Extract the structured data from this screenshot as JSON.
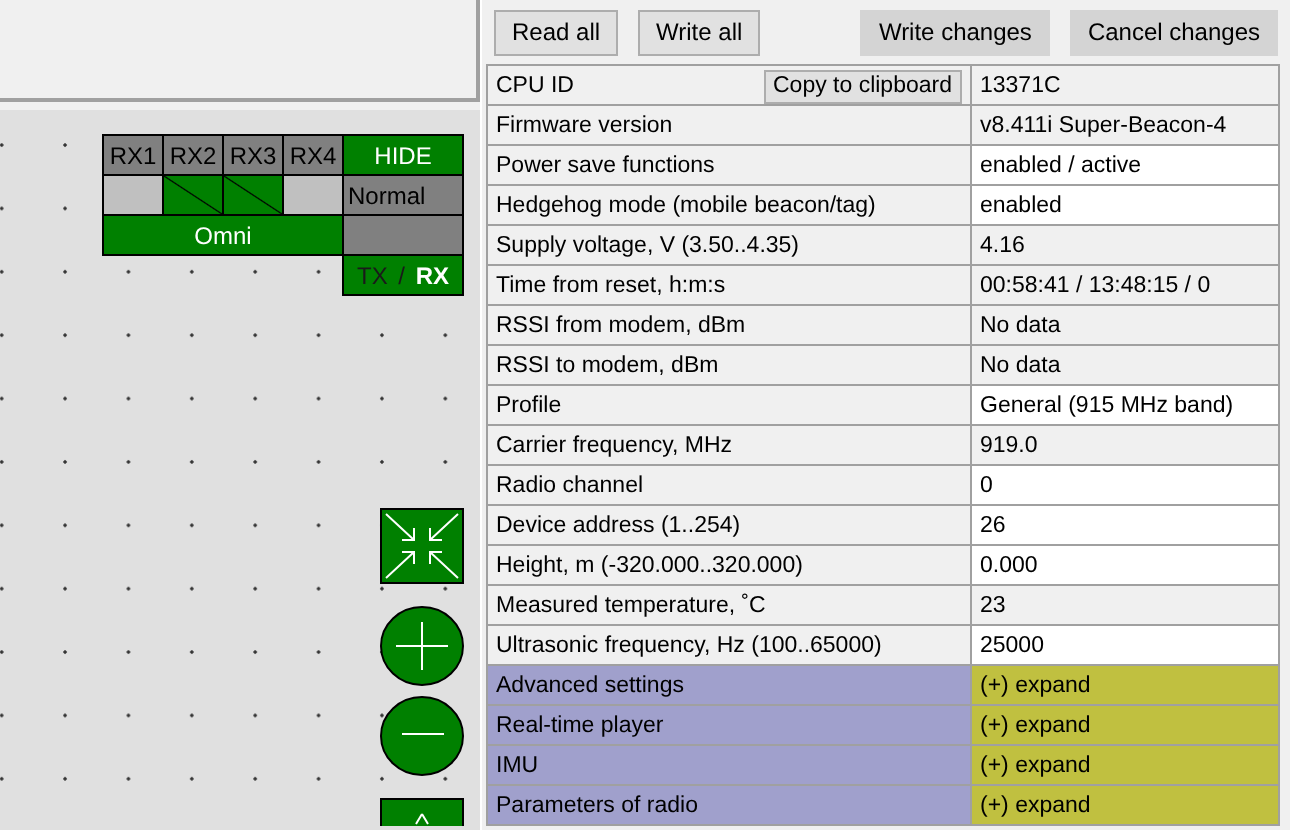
{
  "antenna_panel": {
    "receivers": [
      {
        "label": "RX1",
        "on": false
      },
      {
        "label": "RX2",
        "on": true
      },
      {
        "label": "RX3",
        "on": true
      },
      {
        "label": "RX4",
        "on": false
      }
    ],
    "hide_button": "HIDE",
    "mode": "Normal",
    "pattern": "Omni",
    "tx_rx": "TX / **RX**"
  },
  "toolbar": {
    "buttons": [
      {
        "label": "Read all",
        "shaded": false
      },
      {
        "label": "Write all",
        "shaded": false
      },
      {
        "label": "Write changes",
        "shaded": true
      },
      {
        "label": "Cancel changes",
        "shaded": true
      }
    ]
  },
  "properties": {
    "rows": [
      {
        "kind": "field",
        "label": "CPU ID",
        "action": "Copy to clipboard",
        "value": "13371C",
        "editable": false
      },
      {
        "kind": "field",
        "label": "Firmware version",
        "value": "v8.411i Super-Beacon-4",
        "editable": false
      },
      {
        "kind": "field",
        "label": "Power save functions",
        "value": "enabled / active",
        "editable": true
      },
      {
        "kind": "field",
        "label": "Hedgehog mode (mobile beacon/tag)",
        "value": "enabled",
        "editable": true
      },
      {
        "kind": "field",
        "label": "Supply voltage, V (3.50..4.35)",
        "value": "4.16",
        "editable": false
      },
      {
        "kind": "field",
        "label": "Time from reset, h:m:s",
        "value": "00:58:41 / 13:48:15 / 0",
        "editable": false
      },
      {
        "kind": "field",
        "label": "RSSI from modem, dBm",
        "value": "No data",
        "editable": false
      },
      {
        "kind": "field",
        "label": "RSSI to modem, dBm",
        "value": "No data",
        "editable": false
      },
      {
        "kind": "field",
        "label": "Profile",
        "value": "General (915 MHz band)",
        "editable": true
      },
      {
        "kind": "field",
        "label": "Carrier frequency, MHz",
        "value": "919.0",
        "editable": false
      },
      {
        "kind": "field",
        "label": "Radio channel",
        "value": "0",
        "editable": true
      },
      {
        "kind": "field",
        "label": "Device address (1..254)",
        "value": "26",
        "editable": true
      },
      {
        "kind": "field",
        "label": "Height, m (-320.000..320.000)",
        "value": "0.000",
        "editable": true
      },
      {
        "kind": "field",
        "label": "Measured temperature, ˚C",
        "value": "23",
        "editable": false
      },
      {
        "kind": "field",
        "label": "Ultrasonic frequency, Hz (100..65000)",
        "value": "25000",
        "editable": true
      },
      {
        "kind": "section",
        "label": "Advanced settings",
        "value": "(+) expand"
      },
      {
        "kind": "section",
        "label": "Real-time player",
        "value": "(+) expand"
      },
      {
        "kind": "section",
        "label": "IMU",
        "value": "(+) expand"
      },
      {
        "kind": "section",
        "label": "Parameters of radio",
        "value": "(+) expand"
      }
    ]
  }
}
